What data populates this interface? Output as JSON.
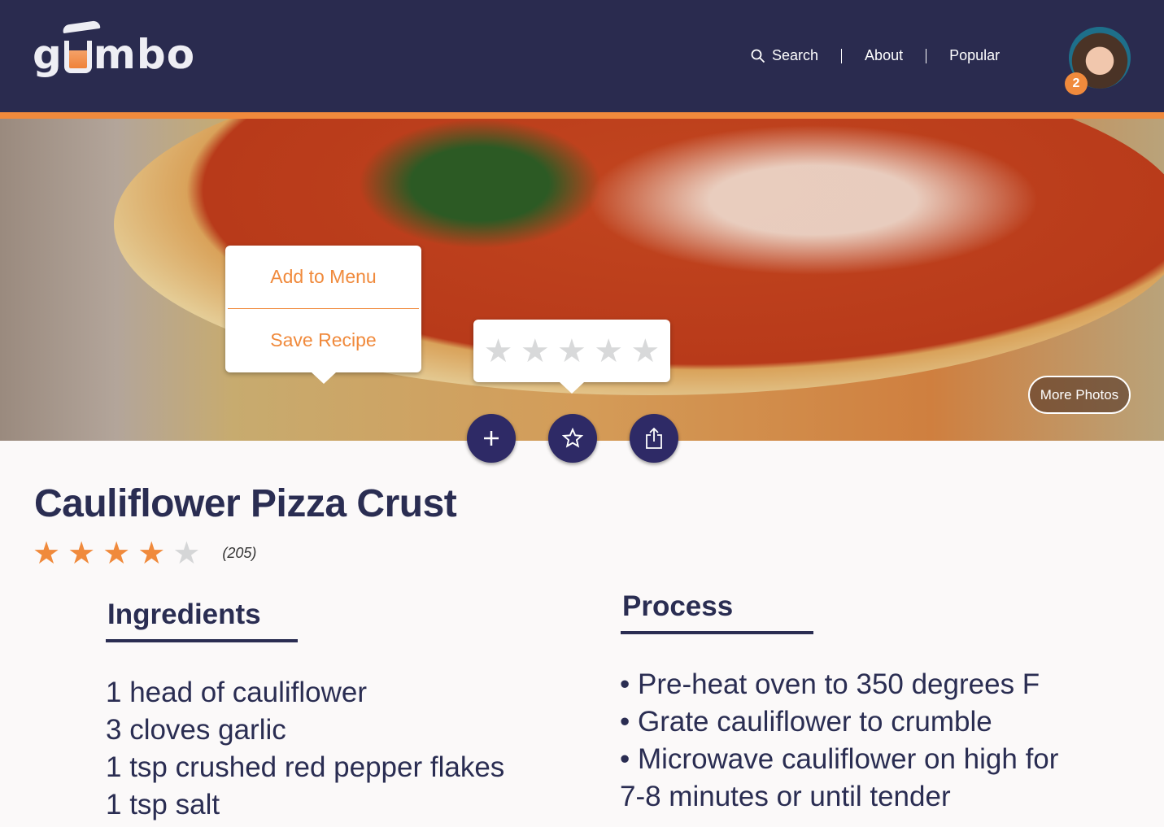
{
  "brand": {
    "logo_text_before": "g",
    "logo_text_after": "mbo"
  },
  "nav": {
    "search": "Search",
    "about": "About",
    "popular": "Popular"
  },
  "user": {
    "notifications": "2"
  },
  "hero": {
    "more_photos": "More Photos"
  },
  "menu_popup": {
    "add_to_menu": "Add to Menu",
    "save_recipe": "Save Recipe"
  },
  "rating_popup": {
    "stars": 5,
    "selected": 0
  },
  "recipe": {
    "title": "Cauliflower Pizza Crust",
    "rating": 4,
    "max_rating": 5,
    "review_count": "(205)"
  },
  "ingredients": {
    "heading": "Ingredients",
    "items": [
      "1 head of cauliflower",
      "3 cloves garlic",
      "1 tsp crushed red pepper flakes",
      "1 tsp salt"
    ]
  },
  "process": {
    "heading": "Process",
    "steps": [
      "• Pre-heat oven to 350 degrees F",
      "• Grate cauliflower to crumble",
      "• Microwave cauliflower on high for",
      "7-8 minutes or until tender"
    ]
  },
  "colors": {
    "header": "#2a2b4f",
    "accent": "#f08a3c",
    "button": "#2e2a66",
    "text": "#2a2d52"
  }
}
